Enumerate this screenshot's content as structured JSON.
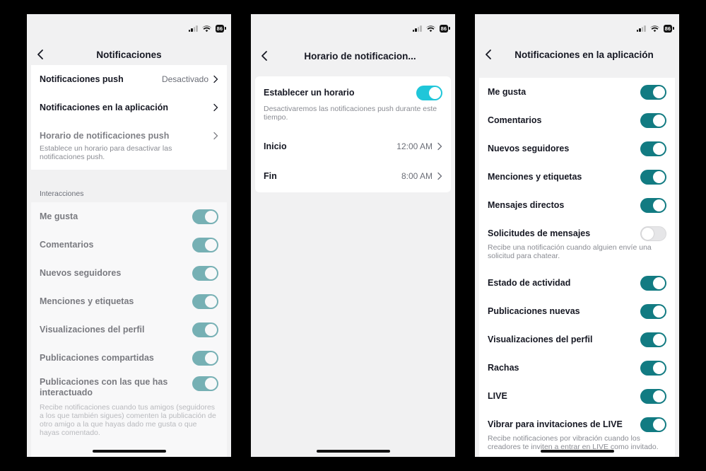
{
  "status": {
    "battery": "86"
  },
  "screen1": {
    "title": "Notificaciones",
    "rows": [
      {
        "label": "Notificaciones push",
        "value": "Desactivado"
      },
      {
        "label": "Notificaciones en la aplicación"
      },
      {
        "label": "Horario de notificaciones push",
        "desc": "Establece un horario para desactivar las notificaciones push."
      }
    ],
    "section_title": "Interacciones",
    "toggles": [
      {
        "label": "Me gusta",
        "on": true
      },
      {
        "label": "Comentarios",
        "on": true
      },
      {
        "label": "Nuevos seguidores",
        "on": true
      },
      {
        "label": "Menciones y etiquetas",
        "on": true
      },
      {
        "label": "Visualizaciones del perfil",
        "on": true
      },
      {
        "label": "Publicaciones compartidas",
        "on": true
      },
      {
        "label": "Publicaciones con las que has interactuado",
        "on": true,
        "desc": "Recibe notificaciones cuando tus amigos (seguidores a los que también sigues) comenten la publicación de otro amigo a la que hayas dado me gusta o que hayas comentado."
      }
    ]
  },
  "screen2": {
    "title": "Horario de notificacion...",
    "schedule_label": "Establecer un horario",
    "schedule_on": true,
    "schedule_desc": "Desactivaremos las notificaciones push durante este tiempo.",
    "start_label": "Inicio",
    "start_value": "12:00 AM",
    "end_label": "Fin",
    "end_value": "8:00 AM"
  },
  "screen3": {
    "title": "Notificaciones en la aplicación",
    "toggles": [
      {
        "label": "Me gusta",
        "on": true
      },
      {
        "label": "Comentarios",
        "on": true
      },
      {
        "label": "Nuevos seguidores",
        "on": true
      },
      {
        "label": "Menciones y etiquetas",
        "on": true
      },
      {
        "label": "Mensajes directos",
        "on": true
      },
      {
        "label": "Solicitudes de mensajes",
        "on": false,
        "desc": "Recibe una notificación cuando alguien envíe una solicitud para chatear."
      },
      {
        "label": "Estado de actividad",
        "on": true
      },
      {
        "label": "Publicaciones nuevas",
        "on": true
      },
      {
        "label": "Visualizaciones del perfil",
        "on": true
      },
      {
        "label": "Rachas",
        "on": true
      },
      {
        "label": "LIVE",
        "on": true
      },
      {
        "label": "Vibrar para invitaciones de LIVE",
        "on": true,
        "desc": "Recibe notificaciones por vibración cuando los creadores te inviten a entrar en LIVE como invitado."
      }
    ]
  },
  "colors": {
    "toggle_on": "#127b82",
    "toggle_bright": "#1fc6d9",
    "toggle_off": "#e6e6e8"
  }
}
